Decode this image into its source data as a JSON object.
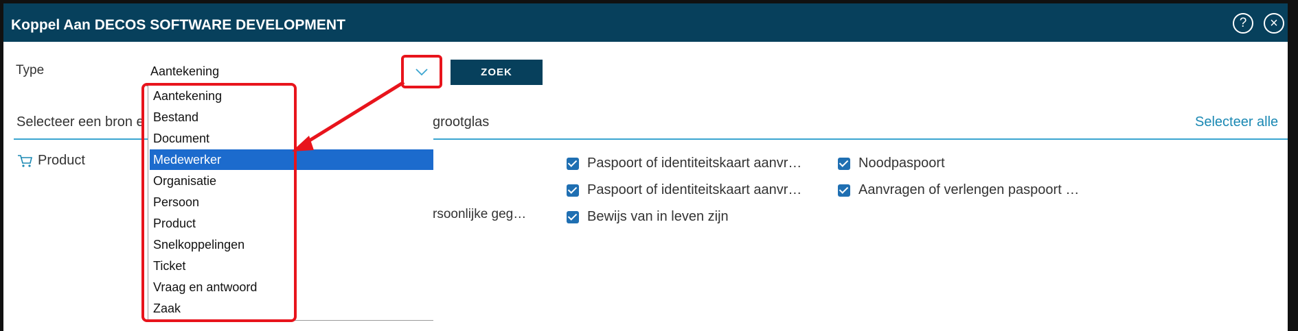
{
  "dialog": {
    "title": "Koppel Aan DECOS SOFTWARE DEVELOPMENT",
    "help_label": "?",
    "close_label": "×"
  },
  "form": {
    "type_label": "Type",
    "type_value": "Aantekening",
    "search_button": "ZOEK"
  },
  "dropdown": {
    "options": [
      "Aantekening",
      "Bestand",
      "Document",
      "Medewerker",
      "Organisatie",
      "Persoon",
      "Product",
      "Snelkoppelingen",
      "Ticket",
      "Vraag en antwoord",
      "Zaak"
    ],
    "highlighted": "Medewerker"
  },
  "section": {
    "text_left": "Selecteer een bron e",
    "text_right": "grootglas",
    "select_all": "Selecteer alle"
  },
  "results": {
    "category": "Product",
    "truncated_text": "rsoonlijke geg…",
    "items": [
      {
        "label": "Paspoort of identiteitskaart aanvr…",
        "checked": true
      },
      {
        "label": "Noodpaspoort",
        "checked": true
      },
      {
        "label": "Paspoort of identiteitskaart aanvr…",
        "checked": true
      },
      {
        "label": "Aanvragen of verlengen paspoort …",
        "checked": true
      },
      {
        "label": "Bewijs van in leven zijn",
        "checked": true
      }
    ]
  },
  "colors": {
    "header": "#07405c",
    "accent": "#1a88b3",
    "selection": "#1c6bcd",
    "annotation": "#e8141c"
  }
}
